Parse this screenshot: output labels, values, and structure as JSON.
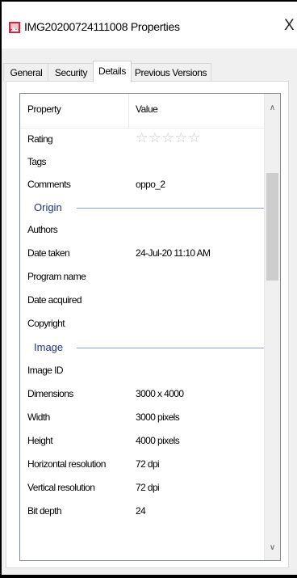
{
  "window": {
    "title": "IMG20200724111008 Properties",
    "close_glyph": "X",
    "icon": "image-file-icon"
  },
  "tabs": [
    "General",
    "Security",
    "Details",
    "Previous Versions"
  ],
  "active_tab": "Details",
  "columns": {
    "property": "Property",
    "value": "Value"
  },
  "rows_top": [
    {
      "name": "Rating",
      "value": "",
      "stars": "☆☆☆☆☆"
    },
    {
      "name": "Tags",
      "value": ""
    },
    {
      "name": "Comments",
      "value": "oppo_2"
    }
  ],
  "group_origin": "Origin",
  "rows_origin": [
    {
      "name": "Authors",
      "value": ""
    },
    {
      "name": "Date taken",
      "value": "24-Jul-20 11:10 AM"
    },
    {
      "name": "Program name",
      "value": ""
    },
    {
      "name": "Date acquired",
      "value": ""
    },
    {
      "name": "Copyright",
      "value": ""
    }
  ],
  "group_image": "Image",
  "rows_image": [
    {
      "name": "Image ID",
      "value": ""
    },
    {
      "name": "Dimensions",
      "value": "3000 x 4000"
    },
    {
      "name": "Width",
      "value": "3000 pixels"
    },
    {
      "name": "Height",
      "value": "4000 pixels"
    },
    {
      "name": "Horizontal resolution",
      "value": "72 dpi"
    },
    {
      "name": "Vertical resolution",
      "value": "72 dpi"
    },
    {
      "name": "Bit depth",
      "value": "24"
    }
  ],
  "scrollbar": {
    "up": "∧",
    "down": "∨"
  },
  "colors": {
    "group_text": "#1e3287",
    "group_line": "#8fa3c8",
    "border": "#828790"
  }
}
